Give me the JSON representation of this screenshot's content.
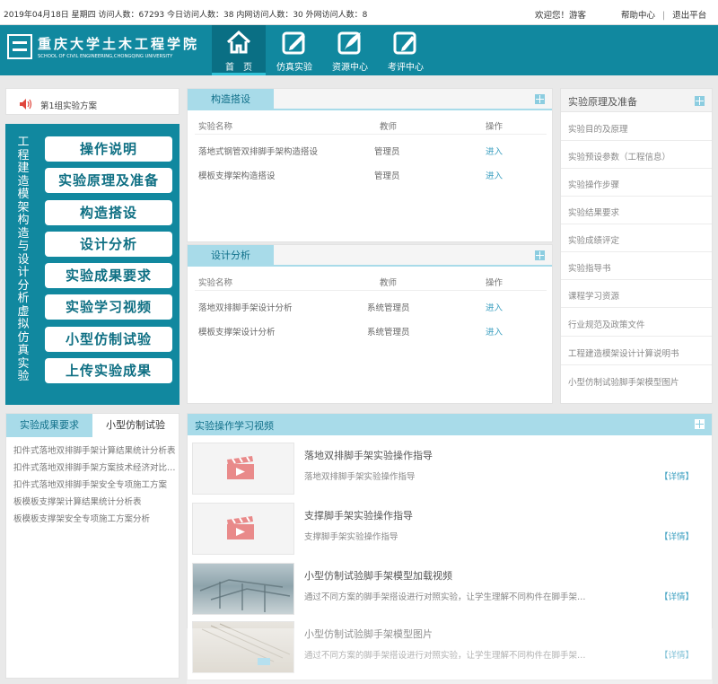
{
  "topbar": {
    "info": "2019年04月18日  星期四  访问人数：67293  今日访问人数：38  内网访问人数：30  外网访问人数：8",
    "welcome": "欢迎您！游客",
    "help": "帮助中心",
    "sep": "|",
    "logout": "退出平台"
  },
  "header": {
    "logo_cn": "重庆大学土木工程学院",
    "logo_en": "SCHOOL OF CIVIL ENGINEERING,CHONGQING UNIVERSITY",
    "nav": [
      {
        "label": "首　页",
        "icon": "home-icon"
      },
      {
        "label": "仿真实验",
        "icon": "edit-icon"
      },
      {
        "label": "资源中心",
        "icon": "feather-icon"
      },
      {
        "label": "考评中心",
        "icon": "pen-icon"
      }
    ]
  },
  "notice": {
    "text": "第1组实验方案"
  },
  "menu": {
    "vertical_title": "工程建造模架构造与设计分析虚拟仿真实验",
    "buttons": [
      "操作说明",
      "实验原理及准备",
      "构造搭设",
      "设计分析",
      "实验成果要求",
      "实验学习视频",
      "小型仿制试验",
      "上传实验成果"
    ]
  },
  "results": {
    "tabs": [
      "实验成果要求",
      "小型仿制试验"
    ],
    "items": [
      "扣件式落地双排脚手架计算结果统计分析表",
      "扣件式落地双排脚手架方案技术经济对比分析",
      "扣件式落地双排脚手架安全专项施工方案",
      "板模板支撑架计算结果统计分析表",
      "板模板支撑架安全专项施工方案分析"
    ]
  },
  "construction": {
    "title": "构造搭设",
    "headers": [
      "实验名称",
      "教师",
      "操作"
    ],
    "rows": [
      {
        "name": "落地式钢管双排脚手架构造搭设",
        "teacher": "管理员",
        "action": "进入"
      },
      {
        "name": "模板支撑架构造搭设",
        "teacher": "管理员",
        "action": "进入"
      }
    ]
  },
  "design": {
    "title": "设计分析",
    "headers": [
      "实验名称",
      "教师",
      "操作"
    ],
    "rows": [
      {
        "name": "落地双排脚手架设计分析",
        "teacher": "系统管理员",
        "action": "进入"
      },
      {
        "name": "模板支撑架设计分析",
        "teacher": "系统管理员",
        "action": "进入"
      }
    ]
  },
  "principle": {
    "title": "实验原理及准备",
    "items": [
      "实验目的及原理",
      "实验预设参数（工程信息）",
      "实验操作步骤",
      "实验结果要求",
      "实验成绩评定",
      "实验指导书",
      "课程学习资源",
      "行业规范及政策文件",
      "工程建造模架设计计算说明书",
      "小型仿制试验脚手架模型图片"
    ]
  },
  "videos": {
    "title": "实验操作学习视频",
    "detail_label": "【详情】",
    "items": [
      {
        "title": "落地双排脚手架实验操作指导",
        "desc": "落地双排脚手架实验操作指导",
        "thumb": "video-placeholder"
      },
      {
        "title": "支撑脚手架实验操作指导",
        "desc": "支撑脚手架实验操作指导",
        "thumb": "video-placeholder"
      },
      {
        "title": "小型仿制试验脚手架模型加载视频",
        "desc": "通过不同方案的脚手架搭设进行对照实验，让学生理解不同构件在脚手架中的作用",
        "thumb": "photo"
      },
      {
        "title": "小型仿制试验脚手架模型图片",
        "desc": "通过不同方案的脚手架搭设进行对照实验，让学生理解不同构件在脚手架中的作用",
        "thumb": "photo"
      }
    ]
  }
}
